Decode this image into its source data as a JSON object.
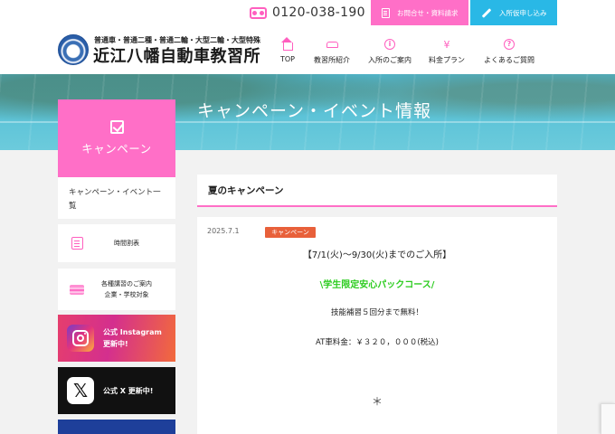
{
  "topbar": {
    "phone": "0120-038-190",
    "inquiry_label": "お問合せ・資料請求",
    "apply_label": "入所仮申し込み"
  },
  "header": {
    "subtitle": "普通車・普通二種・普通二輪・大型二輪・大型特殊",
    "title": "近江八幡自動車教習所",
    "nav": [
      {
        "label": "TOP",
        "icon": "home-icon"
      },
      {
        "label": "教習所紹介",
        "icon": "car-icon"
      },
      {
        "label": "入所のご案内",
        "icon": "info-icon"
      },
      {
        "label": "料金プラン",
        "icon": "yen-icon"
      },
      {
        "label": "よくあるご質問",
        "icon": "question-icon"
      }
    ]
  },
  "hero": {
    "title": "キャンペーン・イベント情報"
  },
  "sidebar": {
    "heading": "キャンペーン",
    "link": "キャンペーン・イベント一覧",
    "cards": [
      {
        "label": "時間割表"
      },
      {
        "label_1": "各種講習のご案内",
        "label_2": "企業・学校対象"
      }
    ],
    "sns": [
      {
        "line_1": "公式 Instagram",
        "line_2": "更新中!"
      },
      {
        "line_1": "公式 X 更新中!"
      }
    ]
  },
  "main": {
    "post_title": "夏のキャンペーン",
    "date": "2025.7.1",
    "tag": "キャンペーン",
    "lines": [
      "【7/1(火)〜9/30(火)までのご入所】",
      "\\学生限定安心パックコース/",
      "技能補習５回分まで無料！",
      "AT車料金：￥３２０，０００(税込)",
      "＊"
    ]
  },
  "colors": {
    "accent_pink": "#ff6fc7",
    "accent_blue": "#29b8e6",
    "highlight_green": "#2ccc1f",
    "tag_orange": "#e8603a"
  }
}
